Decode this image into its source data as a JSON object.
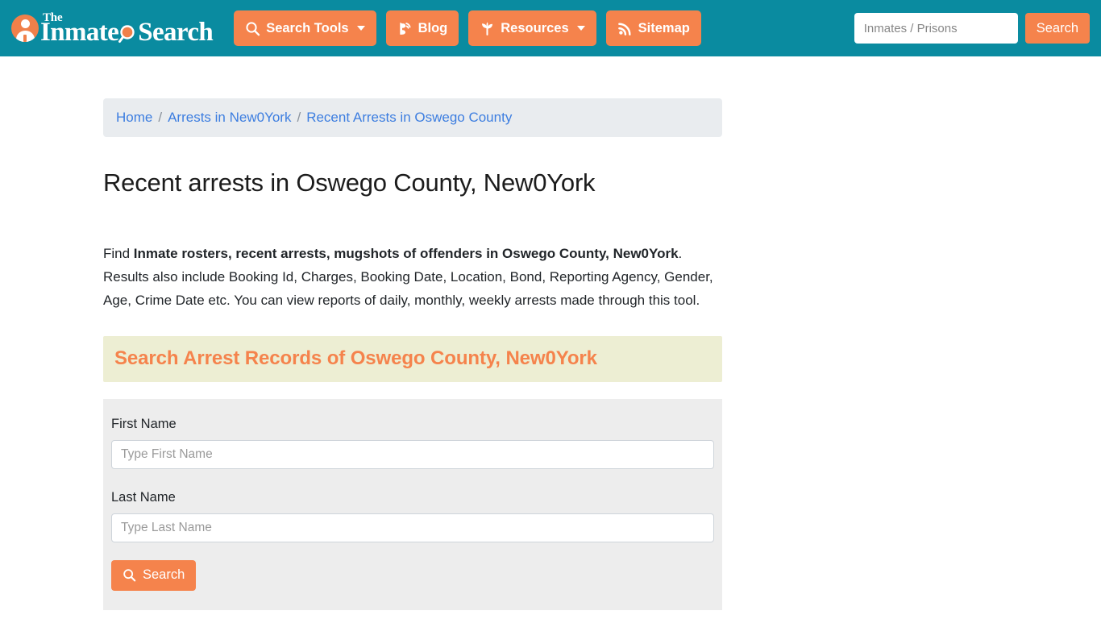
{
  "header": {
    "brand": {
      "the": "The",
      "inmate": "Inmate",
      "search": "Search",
      "icon": "person-circle-icon",
      "glass_icon": "magnifying-glass-icon"
    },
    "nav": [
      {
        "label": "Search Tools",
        "icon": "magnifying-glass-icon",
        "has_caret": true
      },
      {
        "label": "Blog",
        "icon": "blogger-b-icon",
        "has_caret": false
      },
      {
        "label": "Resources",
        "icon": "seedling-icon",
        "has_caret": true
      },
      {
        "label": "Sitemap",
        "icon": "rss-feed-icon",
        "has_caret": false
      }
    ],
    "search": {
      "placeholder": "Inmates / Prisons",
      "value": "",
      "button_label": "Search"
    },
    "colors": {
      "header_bg": "#0a8ba0",
      "accent": "#f5834c"
    }
  },
  "breadcrumb": {
    "items": [
      {
        "label": "Home"
      },
      {
        "label": "Arrests in New0York"
      },
      {
        "label": "Recent Arrests in Oswego County"
      }
    ],
    "separator": "/"
  },
  "main": {
    "title": "Recent arrests in Oswego County, New0York",
    "intro": {
      "lead": "Find ",
      "bold": "Inmate rosters, recent arrests, mugshots of offenders in Oswego County, New0York",
      "rest": ". Results also include Booking Id, Charges, Booking Date, Location, Bond, Reporting Agency, Gender, Age, Crime Date etc. You can view reports of daily, monthly, weekly arrests made through this tool."
    },
    "section_heading": "Search Arrest Records of Oswego County, New0York",
    "form": {
      "first_name": {
        "label": "First Name",
        "placeholder": "Type First Name",
        "value": ""
      },
      "last_name": {
        "label": "Last Name",
        "placeholder": "Type Last Name",
        "value": ""
      },
      "submit_label": "Search",
      "submit_icon": "magnifying-glass-icon"
    },
    "colors": {
      "banner_bg": "#edeed3",
      "banner_text": "#f5834c",
      "panel_bg": "#ededed",
      "breadcrumb_bg": "#e9ecef",
      "link": "#3d7ee0"
    }
  }
}
